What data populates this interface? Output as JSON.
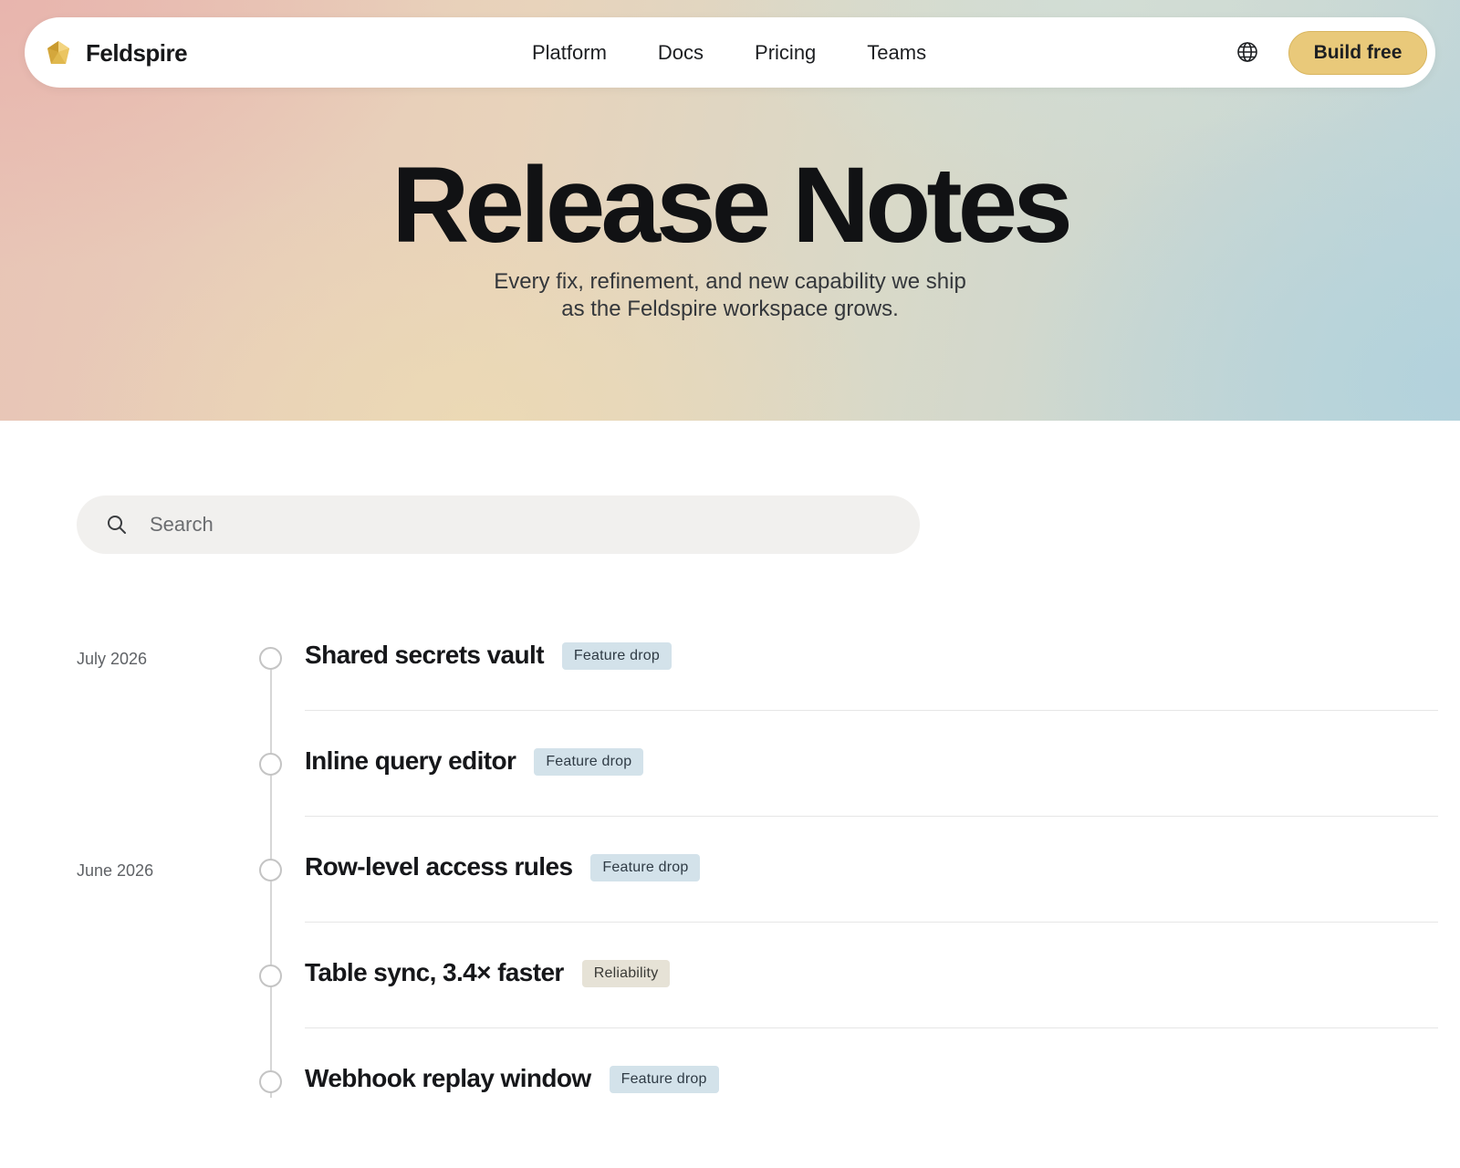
{
  "brand": {
    "name": "Feldspire",
    "logo_icon": "gem-icon"
  },
  "nav": {
    "links": [
      "Platform",
      "Docs",
      "Pricing",
      "Teams"
    ],
    "language_icon": "globe-icon",
    "cta_label": "Build free"
  },
  "hero": {
    "title": "Release Notes",
    "subtitle_line1": "Every fix, refinement, and new capability we ship",
    "subtitle_line2": "as the Feldspire workspace grows."
  },
  "search": {
    "placeholder": "Search",
    "value": "",
    "icon": "search-icon"
  },
  "entries": [
    {
      "date": "July 2026",
      "title": "Shared secrets vault",
      "tag": "Feature drop"
    },
    {
      "date": "",
      "title": "Inline query editor",
      "tag": "Feature drop"
    },
    {
      "date": "June 2026",
      "title": "Row-level access rules",
      "tag": "Feature drop"
    },
    {
      "date": "",
      "title": "Table sync, 3.4× faster",
      "tag": "Reliability"
    },
    {
      "date": "",
      "title": "Webhook replay window",
      "tag": "Feature drop"
    }
  ],
  "colors": {
    "cta": "#e9c97a",
    "tag_feature": "#d3e2ea",
    "tag_reliability": "#e6e2d6"
  }
}
